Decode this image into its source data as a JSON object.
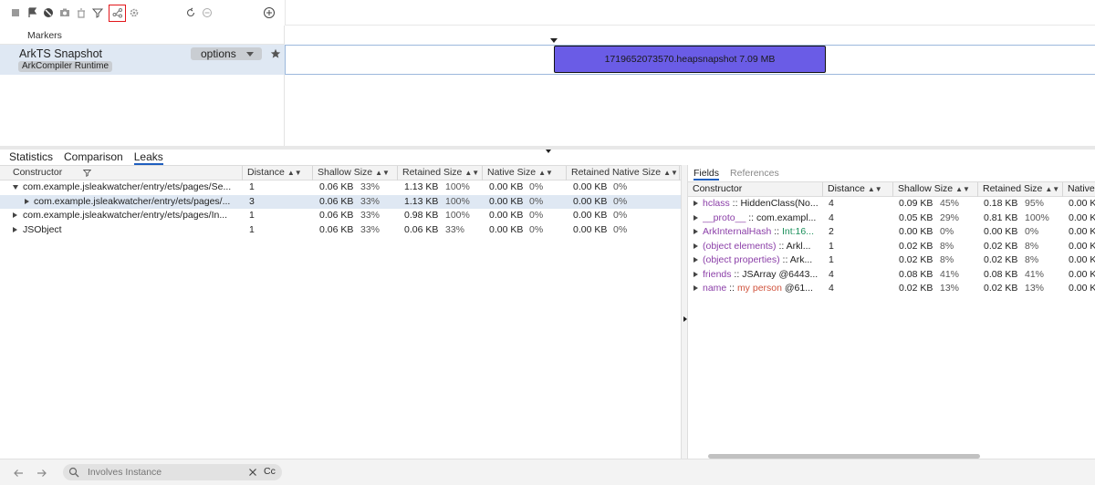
{
  "toolbar": {
    "icons": [
      "stop-icon",
      "flag-icon",
      "block-icon",
      "camera-icon",
      "garbage-icon",
      "filter-icon",
      "graph-icon",
      "gear-icon",
      "refresh-icon",
      "minus-circle-icon",
      "add-icon"
    ]
  },
  "markers": {
    "label": "Markers"
  },
  "snapshot": {
    "title": "ArkTS Snapshot",
    "tag": "ArkCompiler Runtime",
    "options_label": "options",
    "bar_label": "1719652073570.heapsnapshot 7.09 MB"
  },
  "tabs": [
    {
      "label": "Statistics"
    },
    {
      "label": "Comparison"
    },
    {
      "label": "Leaks"
    }
  ],
  "left_table": {
    "headers": {
      "constructor": "Constructor",
      "distance": "Distance",
      "shallow": "Shallow Size",
      "retained": "Retained Size",
      "native": "Native Size",
      "retained_native": "Retained Native Size"
    },
    "rows": [
      {
        "name": "com.example.jsleakwatcher/entry/ets/pages/Se...",
        "distance": "1",
        "shallow": "0.06 KB",
        "shallow_pct": "33%",
        "retained": "1.13 KB",
        "retained_pct": "100%",
        "native": "0.00 KB",
        "native_pct": "0%",
        "rnative": "0.00 KB",
        "rnative_pct": "0%"
      },
      {
        "name": "com.example.jsleakwatcher/entry/ets/pages/...",
        "distance": "3",
        "shallow": "0.06 KB",
        "shallow_pct": "33%",
        "retained": "1.13 KB",
        "retained_pct": "100%",
        "native": "0.00 KB",
        "native_pct": "0%",
        "rnative": "0.00 KB",
        "rnative_pct": "0%"
      },
      {
        "name": "com.example.jsleakwatcher/entry/ets/pages/In...",
        "distance": "1",
        "shallow": "0.06 KB",
        "shallow_pct": "33%",
        "retained": "0.98 KB",
        "retained_pct": "100%",
        "native": "0.00 KB",
        "native_pct": "0%",
        "rnative": "0.00 KB",
        "rnative_pct": "0%"
      },
      {
        "name": "JSObject",
        "distance": "1",
        "shallow": "0.06 KB",
        "shallow_pct": "33%",
        "retained": "0.06 KB",
        "retained_pct": "33%",
        "native": "0.00 KB",
        "native_pct": "0%",
        "rnative": "0.00 KB",
        "rnative_pct": "0%"
      }
    ]
  },
  "right_tabs": [
    {
      "label": "Fields"
    },
    {
      "label": "References"
    }
  ],
  "right_table": {
    "headers": {
      "constructor": "Constructor",
      "distance": "Distance",
      "shallow": "Shallow Size",
      "retained": "Retained Size",
      "native": "Native"
    },
    "rows": [
      {
        "field": "hclass",
        "value": "HiddenClass(No...",
        "vtype": "plain",
        "distance": "4",
        "shallow": "0.09 KB",
        "shallow_pct": "45%",
        "retained": "0.18 KB",
        "retained_pct": "95%",
        "native": "0.00 K"
      },
      {
        "field": "__proto__",
        "value": "com.exampl...",
        "vtype": "plain",
        "distance": "4",
        "shallow": "0.05 KB",
        "shallow_pct": "29%",
        "retained": "0.81 KB",
        "retained_pct": "100%",
        "native": "0.00 K"
      },
      {
        "field": "ArkInternalHash",
        "value": "Int:16...",
        "vtype": "num",
        "distance": "2",
        "shallow": "0.00 KB",
        "shallow_pct": "0%",
        "retained": "0.00 KB",
        "retained_pct": "0%",
        "native": "0.00 K"
      },
      {
        "field": "(object elements)",
        "value": "Arkl...",
        "vtype": "plain",
        "distance": "1",
        "shallow": "0.02 KB",
        "shallow_pct": "8%",
        "retained": "0.02 KB",
        "retained_pct": "8%",
        "native": "0.00 K"
      },
      {
        "field": "(object properties)",
        "value": "Ark...",
        "vtype": "plain",
        "distance": "1",
        "shallow": "0.02 KB",
        "shallow_pct": "8%",
        "retained": "0.02 KB",
        "retained_pct": "8%",
        "native": "0.00 K"
      },
      {
        "field": "friends",
        "value": "JSArray @6443...",
        "vtype": "plain",
        "distance": "4",
        "shallow": "0.08 KB",
        "shallow_pct": "41%",
        "retained": "0.08 KB",
        "retained_pct": "41%",
        "native": "0.00 K"
      },
      {
        "field": "name",
        "value": "my person",
        "value2": " @61...",
        "vtype": "str",
        "distance": "4",
        "shallow": "0.02 KB",
        "shallow_pct": "13%",
        "retained": "0.02 KB",
        "retained_pct": "13%",
        "native": "0.00 K"
      }
    ]
  },
  "field_separator": " :: ",
  "search": {
    "placeholder": "Involves Instance",
    "case_label": "Cc"
  },
  "colors": {
    "accent": "#1f5fbf",
    "bar": "#6a5ce6",
    "selection": "#dfe8f3",
    "highlight_border": "#e2161b"
  }
}
